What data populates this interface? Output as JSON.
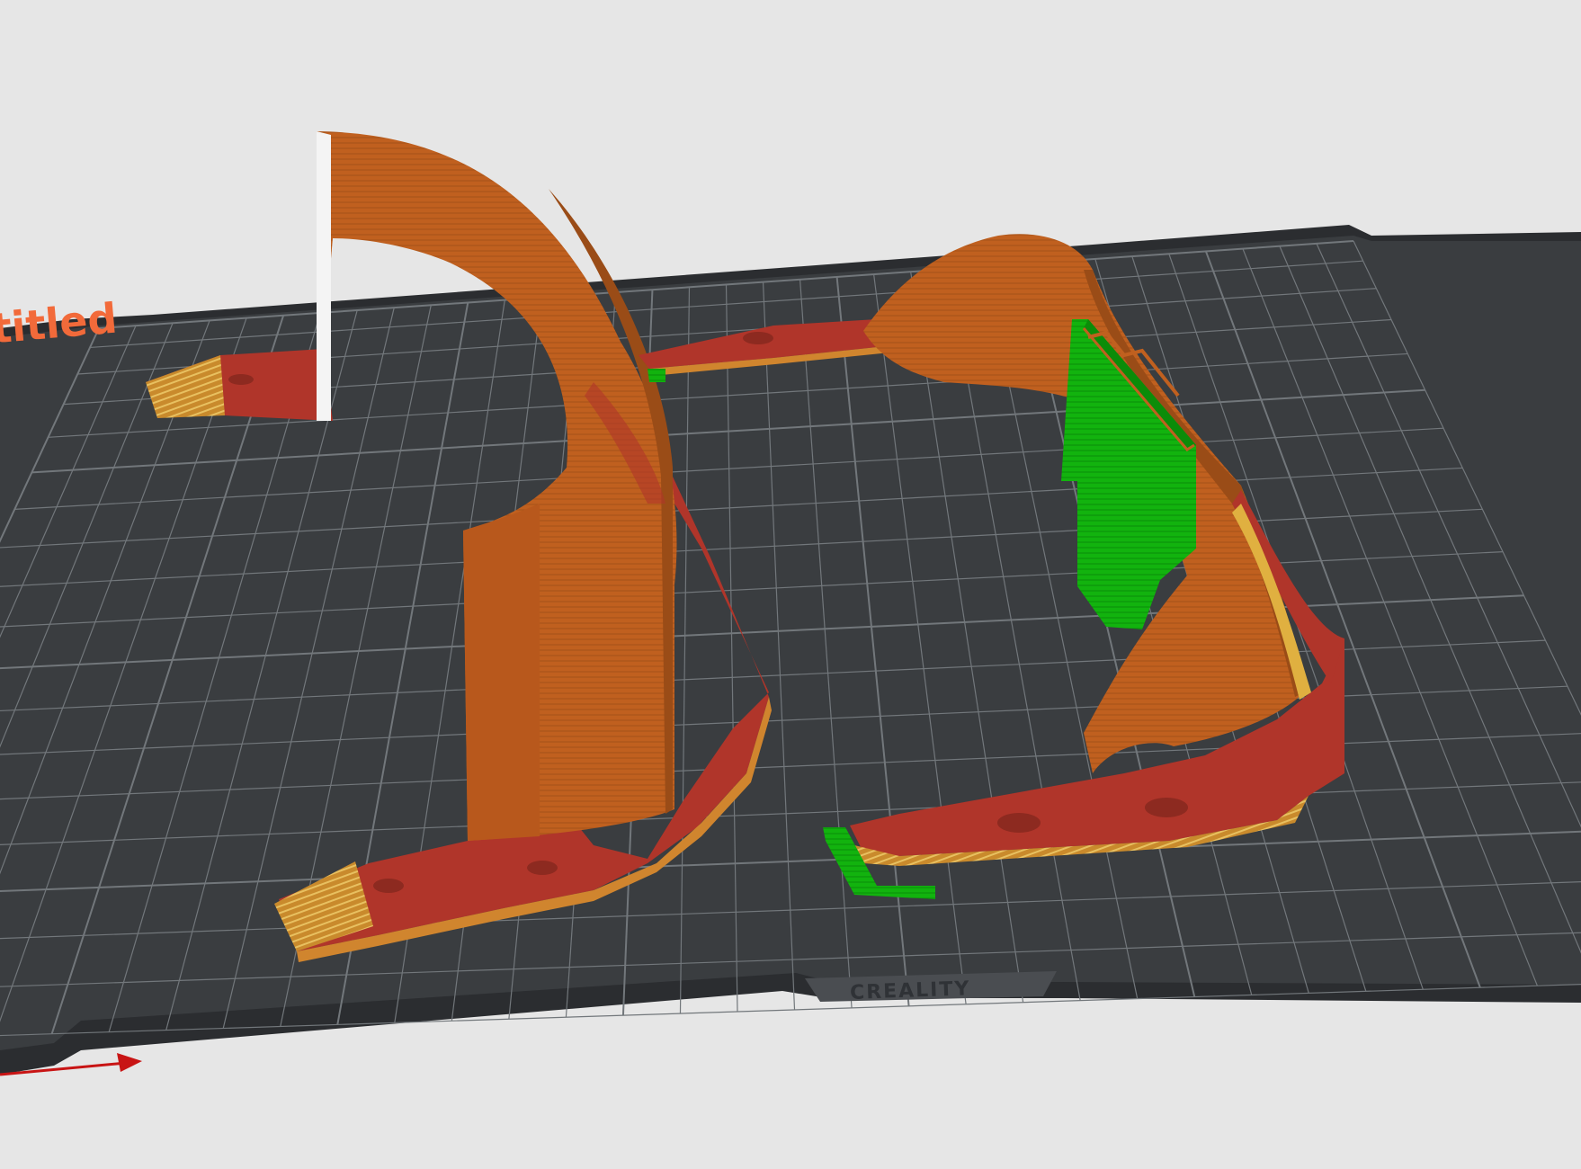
{
  "scene": {
    "plate_title": "titled",
    "bed_brand": "CREALITY"
  },
  "colors": {
    "background": "#e6e6e6",
    "bed": "#3a3d40",
    "bed_edge": "#2b2d30",
    "grid_line": "#72777b",
    "wall": "#c0601f",
    "wall_dark": "#9a4c17",
    "base": "#b0352a",
    "infill": "#d8a24a",
    "support": "#12b30e",
    "axis_x": "#c81414",
    "title": "#f26a3a"
  },
  "icons": {
    "x_axis": "x-axis-arrow-icon"
  }
}
